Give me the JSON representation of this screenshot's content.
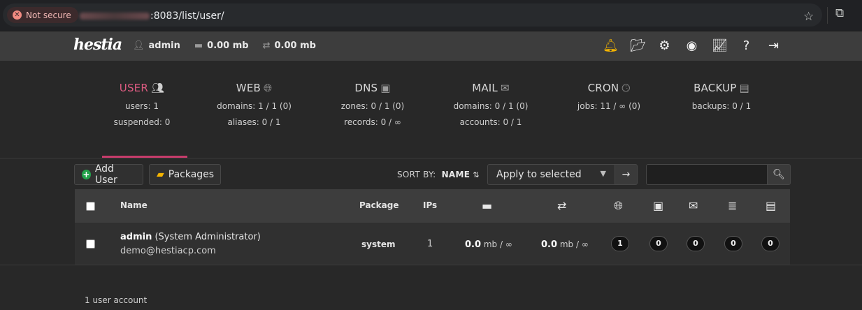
{
  "browser": {
    "security_label": "Not secure",
    "url_path": ":8083/list/user/",
    "star_icon": "star-icon",
    "extensions_icon": "puzzle-icon"
  },
  "topnav": {
    "logo": "hestia",
    "username": "admin",
    "disk_usage": "0.00 mb",
    "bandwidth_usage": "0.00 mb",
    "icons": [
      "bell-icon",
      "folder-icon",
      "gear-icon",
      "user-circle-icon",
      "chart-line-icon",
      "help-icon",
      "logout-icon"
    ],
    "accent": "#f4b400"
  },
  "stats": [
    {
      "title": "USER",
      "icon": "users-icon",
      "lines": [
        "users: 1",
        "suspended: 0"
      ],
      "active": true
    },
    {
      "title": "WEB",
      "icon": "globe-icon",
      "lines": [
        "domains: 1 / 1 (0)",
        "aliases: 0 / 1"
      ]
    },
    {
      "title": "DNS",
      "icon": "address-book-icon",
      "lines": [
        "zones: 0 / 1 (0)",
        "records: 0 / ∞"
      ]
    },
    {
      "title": "MAIL",
      "icon": "mail-bulk-icon",
      "lines": [
        "domains: 0 / 1 (0)",
        "accounts: 0 / 1"
      ]
    },
    {
      "title": "CRON",
      "icon": "clock-icon",
      "lines": [
        "jobs: 11 / ∞ (0)"
      ]
    },
    {
      "title": "BACKUP",
      "icon": "file-archive-icon",
      "lines": [
        "backups: 0 / 1"
      ]
    }
  ],
  "active_color": "#dc5b81",
  "toolbar": {
    "add_user_label": "Add User",
    "packages_label": "Packages",
    "sort_by_label": "SORT BY:",
    "sort_by_value": "NAME",
    "bulk_action_value": "Apply to selected",
    "search_placeholder": ""
  },
  "table": {
    "headers": {
      "name": "Name",
      "package": "Package",
      "ips": "IPs"
    },
    "header_icons": [
      "hdd-icon",
      "exchange-icon",
      "globe-icon",
      "address-book-icon",
      "mail-bulk-icon",
      "database-icon",
      "file-archive-icon"
    ],
    "rows": [
      {
        "username": "admin",
        "fullname": "(System Administrator)",
        "email": "demo@hestiacp.com",
        "package": "system",
        "ips": "1",
        "disk_value": "0.0",
        "disk_unit": "mb / ∞",
        "bandwidth_value": "0.0",
        "bandwidth_unit": "mb / ∞",
        "web": "1",
        "dns": "0",
        "mail": "0",
        "db": "0",
        "backup": "0"
      }
    ]
  },
  "footer": {
    "count_text": "1 user account"
  }
}
